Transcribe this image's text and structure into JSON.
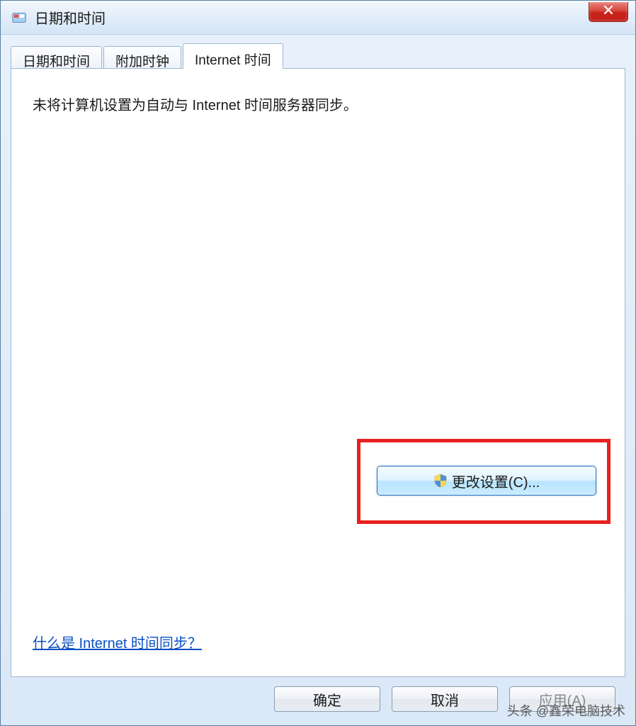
{
  "window": {
    "title": "日期和时间"
  },
  "tabs": [
    {
      "label": "日期和时间",
      "active": false
    },
    {
      "label": "附加时钟",
      "active": false
    },
    {
      "label": "Internet 时间",
      "active": true
    }
  ],
  "panel": {
    "status_text": "未将计算机设置为自动与 Internet 时间服务器同步。",
    "change_button_label": "更改设置(C)...",
    "help_link_text": "什么是 Internet 时间同步？"
  },
  "buttons": {
    "ok": "确定",
    "cancel": "取消",
    "apply": "应用(A)"
  },
  "watermark": "头条 @鑫荣电脑技术"
}
